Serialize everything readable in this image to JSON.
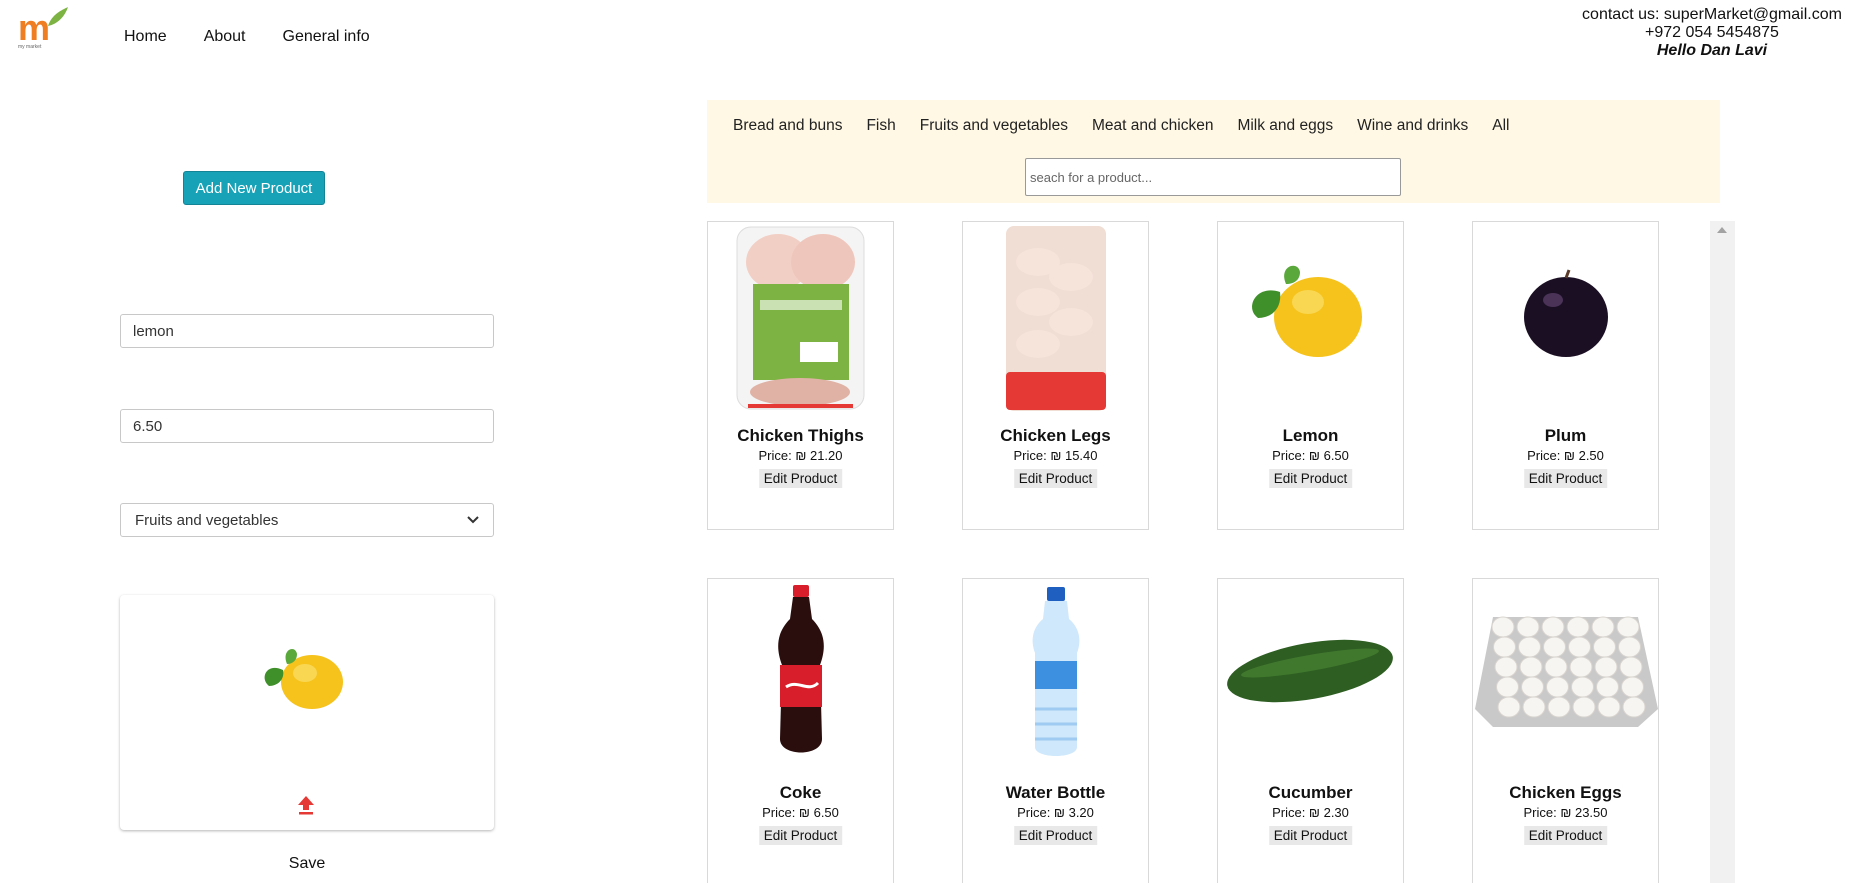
{
  "header": {
    "logo_text": "my market",
    "nav": [
      "Home",
      "About",
      "General info"
    ],
    "contact_email": "contact us: superMarket@gmail.com",
    "contact_phone": "+972 054 5454875",
    "greeting": "Hello Dan Lavi"
  },
  "editor": {
    "add_button": "Add New Product",
    "name_value": "lemon",
    "price_value": "6.50",
    "category_value": "Fruits and vegetables",
    "save_label": "Save",
    "upload_icon": "upload-icon",
    "accent_color": "#17a2b8",
    "upload_color": "#e53935"
  },
  "categories": {
    "items": [
      "Bread and buns",
      "Fish",
      "Fruits and vegetables",
      "Meat and chicken",
      "Milk and eggs",
      "Wine and drinks",
      "All"
    ],
    "search_placeholder": "seach for a product...",
    "bar_color": "#fff8e5"
  },
  "products": [
    {
      "name": "Chicken Thighs",
      "price": "Price: ₪ 21.20",
      "edit": "Edit Product"
    },
    {
      "name": "Chicken Legs",
      "price": "Price: ₪ 15.40",
      "edit": "Edit Product"
    },
    {
      "name": "Lemon",
      "price": "Price: ₪ 6.50",
      "edit": "Edit Product"
    },
    {
      "name": "Plum",
      "price": "Price: ₪ 2.50",
      "edit": "Edit Product"
    },
    {
      "name": "Coke",
      "price": "Price: ₪ 6.50",
      "edit": "Edit Product"
    },
    {
      "name": "Water Bottle",
      "price": "Price: ₪ 3.20",
      "edit": "Edit Product"
    },
    {
      "name": "Cucumber",
      "price": "Price: ₪ 2.30",
      "edit": "Edit Product"
    },
    {
      "name": "Chicken Eggs",
      "price": "Price: ₪ 23.50",
      "edit": "Edit Product"
    }
  ]
}
